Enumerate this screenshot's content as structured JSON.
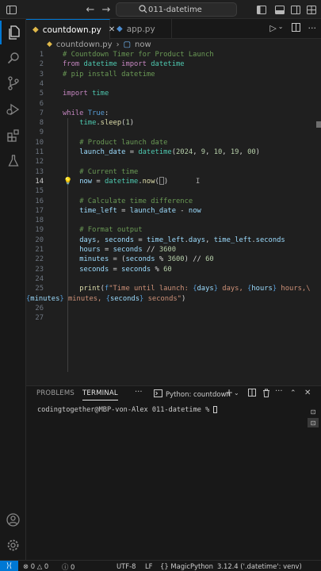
{
  "titlebar": {
    "search_text": "011-datetime"
  },
  "tabs": [
    {
      "label": "countdown.py"
    },
    {
      "label": "app.py"
    }
  ],
  "breadcrumb": {
    "file": "countdown.py",
    "symbol": "now"
  },
  "editor": {
    "current_line": 14,
    "lines": [
      {
        "n": "1"
      },
      {
        "n": "2"
      },
      {
        "n": "3"
      },
      {
        "n": "4"
      },
      {
        "n": "5"
      },
      {
        "n": "6"
      },
      {
        "n": "7"
      },
      {
        "n": "8"
      },
      {
        "n": "9"
      },
      {
        "n": "10"
      },
      {
        "n": "11"
      },
      {
        "n": "12"
      },
      {
        "n": "13"
      },
      {
        "n": "14"
      },
      {
        "n": "15"
      },
      {
        "n": "16"
      },
      {
        "n": "17"
      },
      {
        "n": "18"
      },
      {
        "n": "19"
      },
      {
        "n": "20"
      },
      {
        "n": "21"
      },
      {
        "n": "22"
      },
      {
        "n": "23"
      },
      {
        "n": "24"
      },
      {
        "n": "25"
      },
      {
        "n": "26"
      },
      {
        "n": "27"
      }
    ],
    "code": {
      "l1": "# Countdown Timer for Product Launch",
      "l2_from": "from",
      "l2_mod": "datetime",
      "l2_import": "import",
      "l2_name": "datetime",
      "l3": "# pip install datetime",
      "l5_import": "import",
      "l5_mod": "time",
      "l7_while": "while",
      "l7_true": "True",
      "l7_colon": ":",
      "l8_obj": "time",
      "l8_fn": "sleep",
      "l8_arg": "1",
      "l10": "# Product launch date",
      "l11_var": "launch_date",
      "l11_cls": "datetime",
      "l11_args": [
        "2024",
        "9",
        "10",
        "19",
        "00"
      ],
      "l13": "# Current time",
      "l14_var": "now",
      "l14_cls": "datetime",
      "l14_fn": "now",
      "l16": "# Calculate time difference",
      "l17_var": "time_left",
      "l17_a": "launch_date",
      "l17_b": "now",
      "l19": "# Format output",
      "l20_a": "days",
      "l20_b": "seconds",
      "l20_c": "time_left",
      "l20_d": "days",
      "l20_e": "time_left",
      "l20_f": "seconds",
      "l21_var": "hours",
      "l21_src": "seconds",
      "l21_num": "3600",
      "l22_var": "minutes",
      "l22_src": "seconds",
      "l22_num1": "3600",
      "l22_num2": "60",
      "l23_var": "seconds",
      "l23_src": "seconds",
      "l23_num": "60",
      "l25_fn": "print",
      "l25_str1": "\"Time until launch: ",
      "l25_v1": "days",
      "l25_str2": " days, ",
      "l25_v2": "hours",
      "l25_str3": " hours,\\",
      "l26_v1": "minutes",
      "l26_str1": " minutes, ",
      "l26_v2": "seconds",
      "l26_str2": " seconds\""
    }
  },
  "panel": {
    "tab_problems": "PROBLEMS",
    "tab_terminal": "TERMINAL",
    "terminal_name": "Python: countdown",
    "prompt": "codingtogether@MBP-von-Alex 011-datetime % "
  },
  "statusbar": {
    "errors": "0",
    "warnings": "0",
    "infos": "0",
    "encoding": "UTF-8",
    "eol": "LF",
    "extension": "MagicPython",
    "interpreter": "3.12.4 ('.datetime': venv)"
  },
  "colors": {
    "accent": "#0078d4",
    "editor_bg": "#1f1f1f",
    "chrome_bg": "#181818"
  }
}
